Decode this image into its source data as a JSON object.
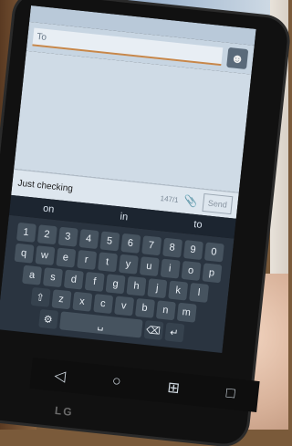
{
  "to_label": "To",
  "compose_text": "Just checking",
  "char_counter": "147/1",
  "send_label": "Send",
  "suggestions": [
    "on",
    "in",
    "to"
  ],
  "keyboard": {
    "numbers": [
      "1",
      "2",
      "3",
      "4",
      "5",
      "6",
      "7",
      "8",
      "9",
      "0"
    ],
    "row1": [
      "q",
      "w",
      "e",
      "r",
      "t",
      "y",
      "u",
      "i",
      "o",
      "p"
    ],
    "row2": [
      "a",
      "s",
      "d",
      "f",
      "g",
      "h",
      "j",
      "k",
      "l"
    ],
    "row3": [
      "z",
      "x",
      "c",
      "v",
      "b",
      "n",
      "m"
    ]
  },
  "brand": "LG",
  "icons": {
    "contact": "person-icon",
    "attach": "paperclip-icon",
    "back": "back-triangle-icon",
    "home": "home-circle-icon",
    "apps": "grid-icon",
    "recent": "square-icon"
  }
}
